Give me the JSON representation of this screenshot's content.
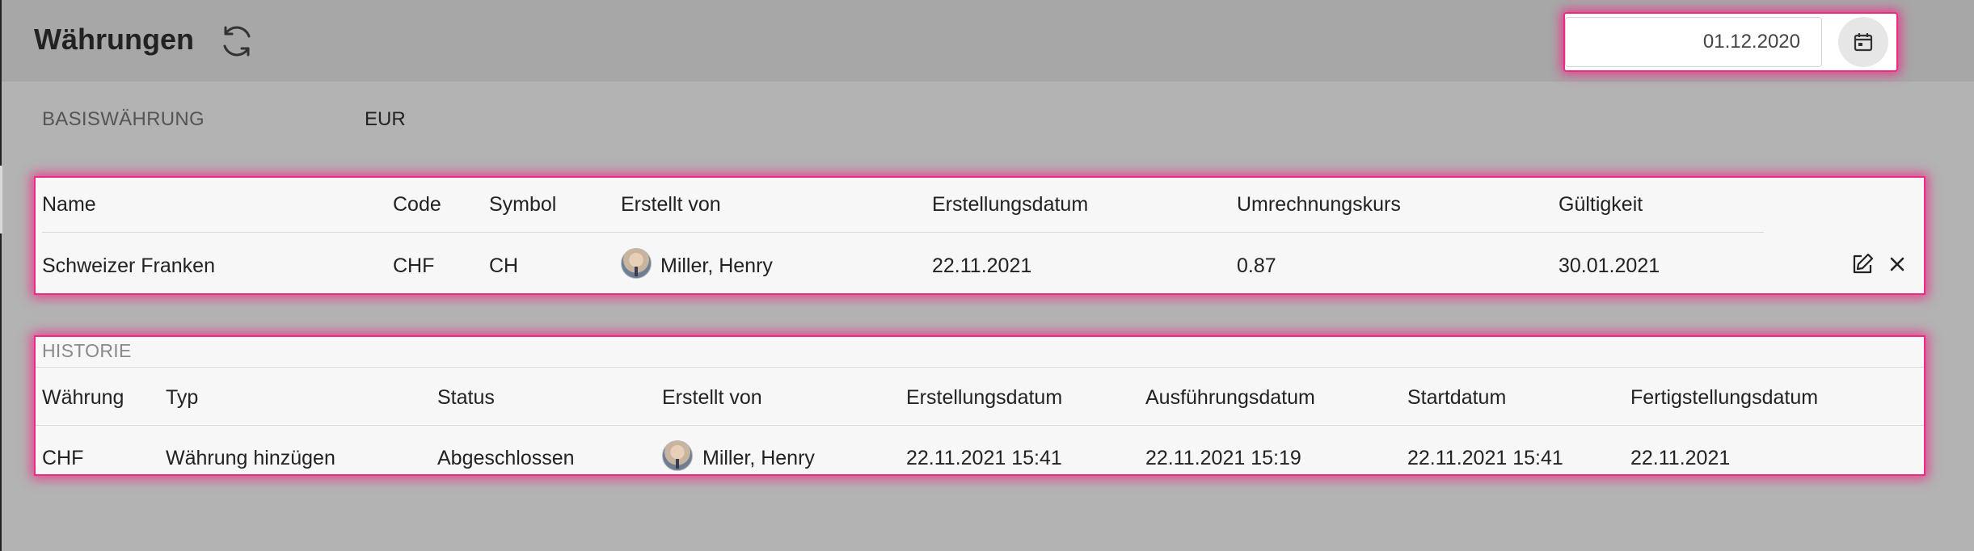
{
  "header": {
    "title": "Währungen",
    "refresh_icon": "refresh-icon",
    "date_value": "01.12.2020",
    "calendar_icon": "calendar-icon"
  },
  "base_currency": {
    "label": "BASISWÄHRUNG",
    "value": "EUR"
  },
  "currencies": {
    "columns": [
      "Name",
      "Code",
      "Symbol",
      "Erstellt von",
      "Erstellungsdatum",
      "Umrechnungskurs",
      "Gültigkeit"
    ],
    "rows": [
      {
        "name": "Schweizer Franken",
        "code": "CHF",
        "symbol": "CH",
        "created_by": "Miller, Henry",
        "created_on": "22.11.2021",
        "rate": "0.87",
        "valid_until": "30.01.2021",
        "actions": [
          "edit-icon",
          "close-icon"
        ]
      }
    ]
  },
  "history": {
    "title": "HISTORIE",
    "columns": [
      "Währung",
      "Typ",
      "Status",
      "Erstellt von",
      "Erstellungsdatum",
      "Ausführungsdatum",
      "Startdatum",
      "Fertigstellungsdatum"
    ],
    "rows": [
      {
        "currency": "CHF",
        "type": "Währung hinzügen",
        "status": "Abgeschlossen",
        "created_by": "Miller, Henry",
        "created_on": "22.11.2021 15:41",
        "executed_on": "22.11.2021 15:19",
        "start_date": "22.11.2021 15:41",
        "completed_on": "22.11.2021"
      }
    ]
  }
}
